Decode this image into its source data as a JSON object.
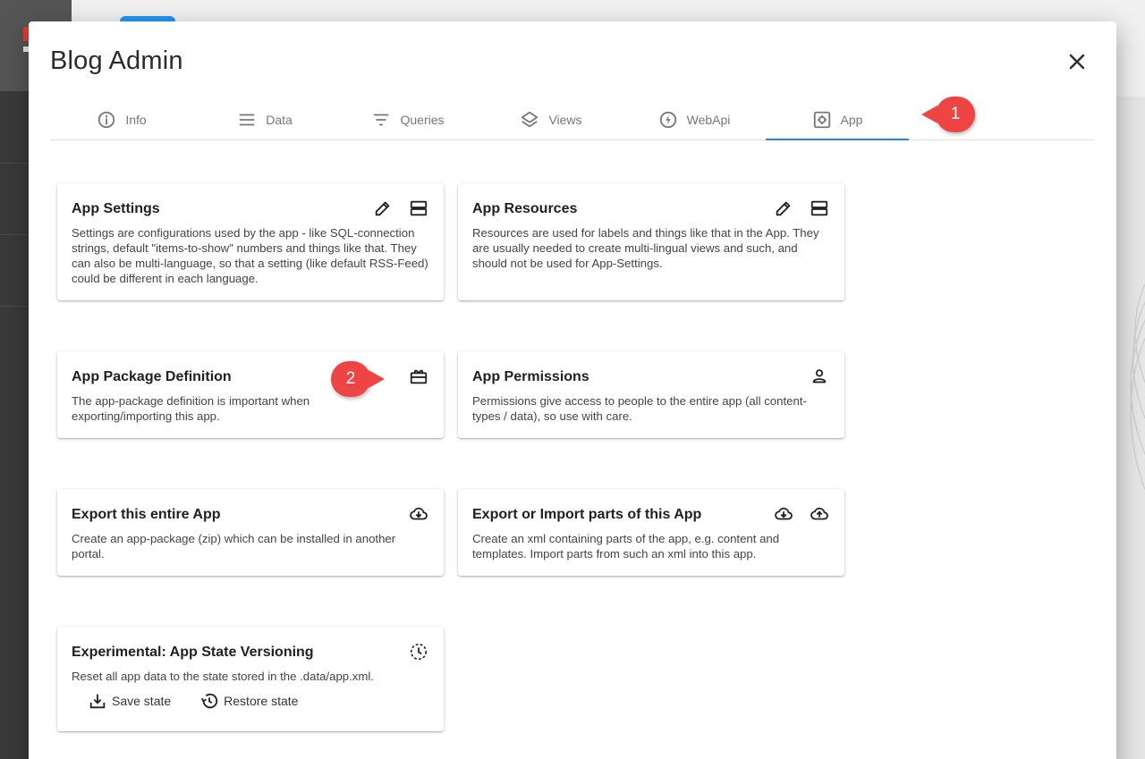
{
  "dialog": {
    "title": "Blog Admin"
  },
  "tabs": [
    {
      "label": "Info",
      "icon": "info-icon"
    },
    {
      "label": "Data",
      "icon": "menu-lines-icon"
    },
    {
      "label": "Queries",
      "icon": "filter-icon"
    },
    {
      "label": "Views",
      "icon": "layers-icon"
    },
    {
      "label": "WebApi",
      "icon": "lightning-icon"
    },
    {
      "label": "App",
      "icon": "settings-app-icon"
    }
  ],
  "active_tab": "App",
  "callouts": {
    "one": "1",
    "two": "2"
  },
  "cards": {
    "settings": {
      "title": "App Settings",
      "desc": "Settings are configurations used by the app - like SQL-connection strings, default \"items-to-show\" numbers and things like that. They can also be multi-language, so that a setting (like default RSS-Feed) could be different in each language."
    },
    "resources": {
      "title": "App Resources",
      "desc": "Resources are used for labels and things like that in the App. They are usually needed to create multi-lingual views and such, and should not be used for App-Settings."
    },
    "package": {
      "title": "App Package Definition",
      "desc": "The app-package definition is important when exporting/importing this app."
    },
    "permissions": {
      "title": "App Permissions",
      "desc": "Permissions give access to people to the entire app (all content-types / data), so use with care."
    },
    "export_app": {
      "title": "Export this entire App",
      "desc": "Create an app-package (zip) which can be installed in another portal."
    },
    "export_import": {
      "title": "Export or Import parts of this App",
      "desc": "Create an xml containing parts of the app, e.g. content and templates. Import parts from such an xml into this app."
    },
    "versioning": {
      "title": "Experimental: App State Versioning",
      "desc": "Reset all app data to the state stored in the .data/app.xml.",
      "save_label": "Save state",
      "restore_label": "Restore state"
    }
  },
  "colors": {
    "accent": "#1e88e5",
    "callout": "#ef4444"
  }
}
